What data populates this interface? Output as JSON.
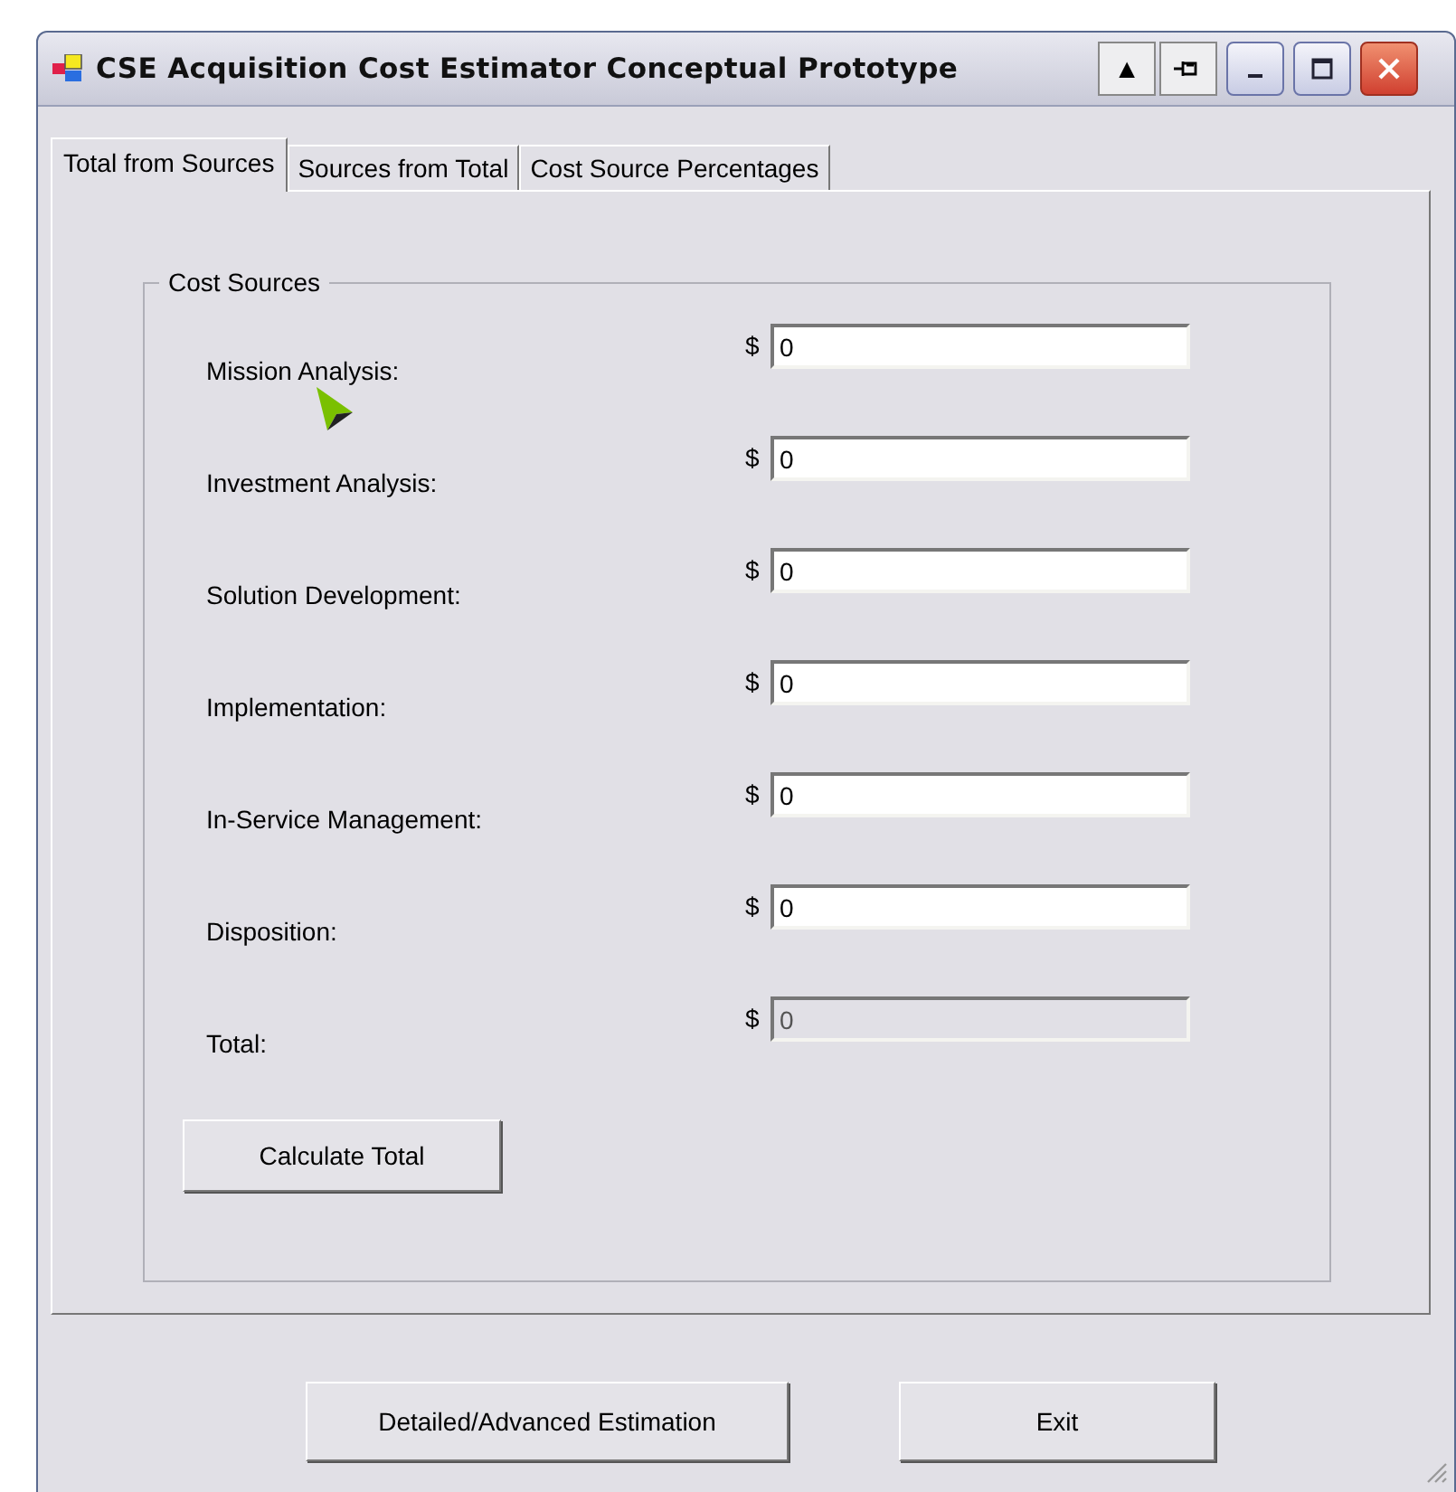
{
  "window": {
    "title": "CSE Acquisition Cost Estimator Conceptual Prototype"
  },
  "title_buttons": [
    {
      "kind": "up",
      "label": "▲"
    },
    {
      "kind": "pin"
    },
    {
      "kind": "minimize"
    },
    {
      "kind": "maximize"
    },
    {
      "kind": "close"
    }
  ],
  "tabs": [
    {
      "label": "Total from Sources",
      "selected": true
    },
    {
      "label": "Sources from Total",
      "selected": false
    },
    {
      "label": "Cost Source Percentages",
      "selected": false
    }
  ],
  "group": {
    "title": "Cost Sources",
    "fields": [
      {
        "label": "Mission Analysis:",
        "currency": "$",
        "value": "0",
        "disabled": false
      },
      {
        "label": "Investment Analysis:",
        "currency": "$",
        "value": "0",
        "disabled": false
      },
      {
        "label": "Solution Development:",
        "currency": "$",
        "value": "0",
        "disabled": false
      },
      {
        "label": "Implementation:",
        "currency": "$",
        "value": "0",
        "disabled": false
      },
      {
        "label": "In-Service Management:",
        "currency": "$",
        "value": "0",
        "disabled": false
      },
      {
        "label": "Disposition:",
        "currency": "$",
        "value": "0",
        "disabled": false
      },
      {
        "label": "Total:",
        "currency": "$",
        "value": "0",
        "disabled": true
      }
    ],
    "button": "Calculate Total"
  },
  "buttons": [
    "Detailed/Advanced Estimation",
    "Exit"
  ]
}
